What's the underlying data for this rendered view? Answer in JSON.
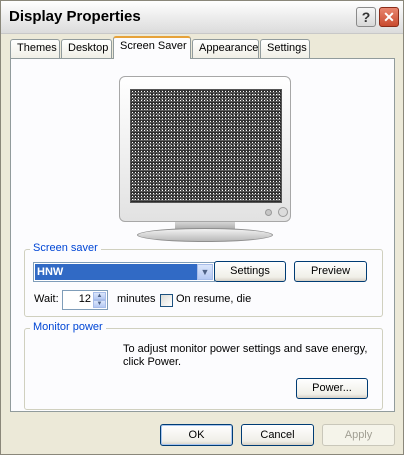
{
  "window": {
    "title": "Display Properties"
  },
  "title_buttons": {
    "help": "?",
    "close": "✕"
  },
  "tabs": [
    {
      "label": "Themes"
    },
    {
      "label": "Desktop"
    },
    {
      "label": "Screen Saver"
    },
    {
      "label": "Appearance"
    },
    {
      "label": "Settings"
    }
  ],
  "active_tab": "Screen Saver",
  "screen_saver": {
    "group_label": "Screen saver",
    "selected": "HNW",
    "settings_button": "Settings",
    "preview_button": "Preview",
    "wait_label": "Wait:",
    "wait_value": "12",
    "minutes_label": "minutes",
    "on_resume_label": "On resume, die",
    "on_resume_checked": false
  },
  "monitor_power": {
    "group_label": "Monitor power",
    "description": "To adjust monitor power settings and save energy, click Power.",
    "power_button": "Power..."
  },
  "footer": {
    "ok": "OK",
    "cancel": "Cancel",
    "apply": "Apply"
  }
}
